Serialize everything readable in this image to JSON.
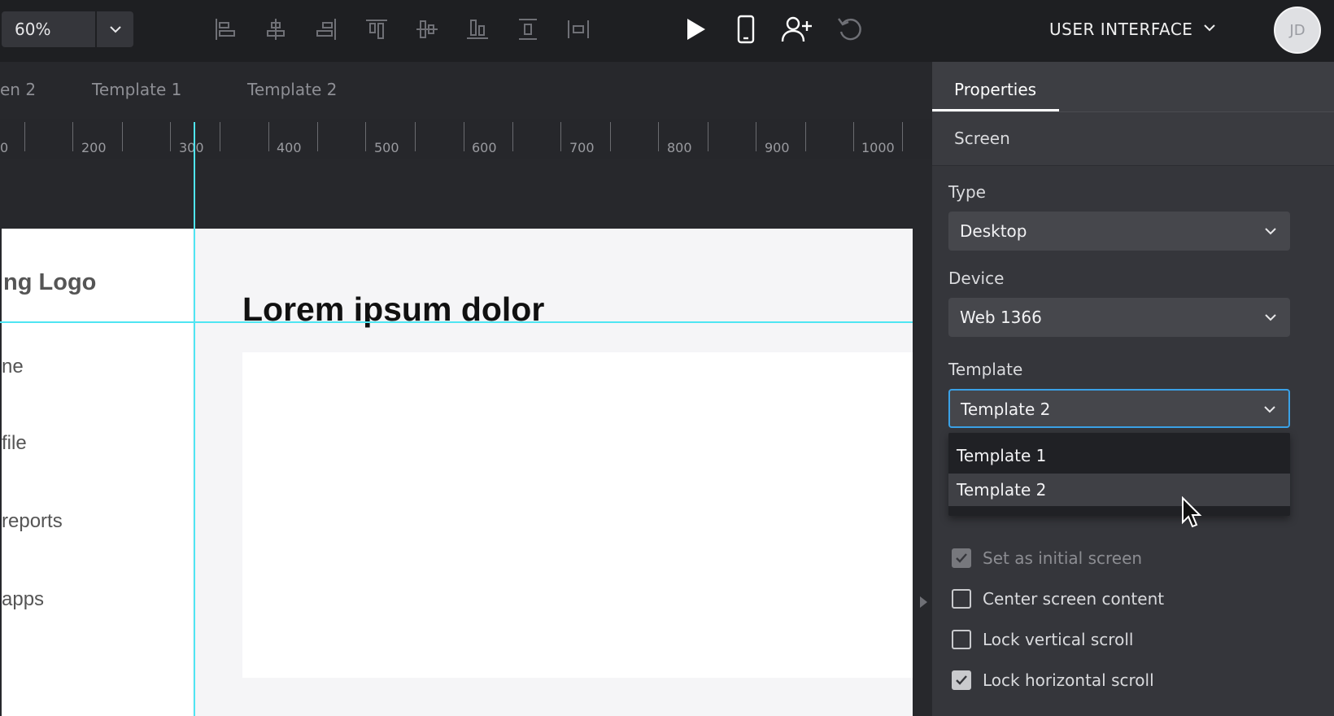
{
  "toolbar": {
    "zoom": "60%",
    "project_menu": "USER INTERFACE",
    "avatar_initials": "JD",
    "icons": [
      "align-left-icon",
      "align-center-h-icon",
      "align-right-icon",
      "align-top-icon",
      "align-middle-v-icon",
      "align-bottom-icon",
      "distribute-vertical-icon",
      "distribute-horizontal-icon",
      "play-icon",
      "mobile-preview-icon",
      "add-user-icon",
      "undo-icon"
    ]
  },
  "screen_tabs": [
    "en 2",
    "Template 1",
    "Template 2"
  ],
  "ruler": {
    "labels": [
      "0",
      "200",
      "300",
      "400",
      "500",
      "600",
      "700",
      "800",
      "900",
      "1000"
    ]
  },
  "artboard": {
    "logo": "ing Logo",
    "heading": "Lorem ipsum dolor",
    "nav": [
      "ne",
      "file",
      "reports",
      "apps"
    ]
  },
  "panel": {
    "tab": "Properties",
    "section": "Screen",
    "type_label": "Type",
    "type_value": "Desktop",
    "device_label": "Device",
    "device_value": "Web 1366",
    "template_label": "Template",
    "template_value": "Template 2",
    "template_options": [
      "Template 1",
      "Template 2"
    ],
    "checkboxes": [
      {
        "label": "Set as initial screen",
        "checked": true,
        "disabled": true
      },
      {
        "label": "Center screen content",
        "checked": false,
        "disabled": false
      },
      {
        "label": "Lock vertical scroll",
        "checked": false,
        "disabled": false
      },
      {
        "label": "Lock horizontal scroll",
        "checked": true,
        "disabled": false
      }
    ]
  },
  "colors": {
    "guide": "#4fe5f2",
    "focus_border": "#3ba1e6",
    "panel_bg": "#35363b",
    "toolbar_bg": "#1e1f22"
  }
}
